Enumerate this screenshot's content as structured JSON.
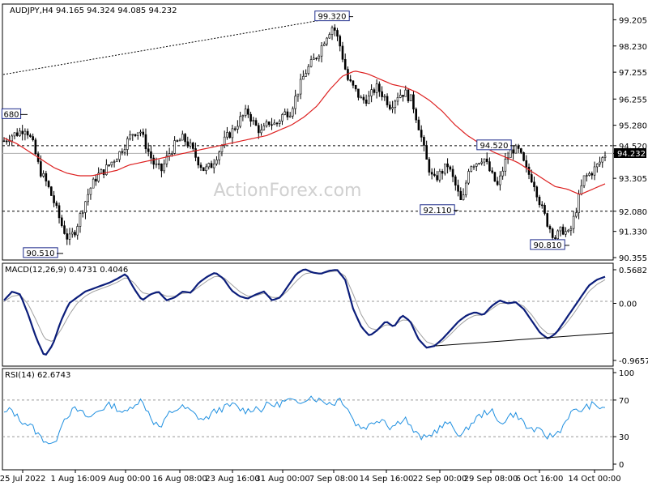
{
  "chart_data": [
    {
      "type": "candlestick",
      "title": "AUDJPY,H4  94.165 94.324 94.085 94.232",
      "watermark": "ActionForex.com",
      "last_price": "94.232",
      "y_ticks": [
        "99.205",
        "98.230",
        "97.255",
        "96.255",
        "95.280",
        "94.520",
        "94.232",
        "93.305",
        "92.080",
        "91.330",
        "90.355"
      ],
      "ylim": [
        90.355,
        99.7
      ],
      "close_path": [
        94.7,
        94.9,
        95.0,
        95.2,
        94.6,
        93.6,
        93.1,
        92.4,
        91.6,
        91.0,
        91.4,
        92.2,
        92.9,
        93.4,
        93.6,
        93.9,
        94.2,
        94.6,
        95.0,
        95.1,
        94.4,
        93.8,
        93.6,
        94.2,
        94.6,
        94.8,
        94.5,
        94.0,
        93.6,
        93.8,
        94.3,
        94.8,
        95.1,
        95.5,
        95.8,
        95.3,
        95.0,
        95.4,
        95.3,
        95.7,
        95.8,
        96.5,
        97.2,
        97.6,
        98.0,
        98.6,
        99.0,
        98.2,
        97.0,
        96.6,
        96.2,
        96.3,
        96.7,
        96.4,
        96.0,
        96.4,
        96.5,
        96.2,
        95.2,
        94.0,
        93.2,
        93.5,
        93.8,
        93.1,
        92.3,
        93.8,
        93.9,
        94.1,
        93.5,
        93.0,
        93.9,
        94.4,
        94.3,
        93.6,
        93.2,
        92.3,
        91.6,
        91.1,
        91.4,
        91.2,
        92.2,
        93.3,
        93.5,
        93.8,
        94.2
      ],
      "sma_path": [
        94.8,
        94.6,
        94.3,
        94.0,
        93.7,
        93.5,
        93.4,
        93.4,
        93.5,
        93.6,
        93.8,
        93.9,
        94.0,
        94.1,
        94.2,
        94.3,
        94.4,
        94.5,
        94.6,
        94.7,
        94.8,
        94.9,
        95.1,
        95.3,
        95.6,
        96.0,
        96.6,
        97.1,
        97.3,
        97.2,
        97.0,
        96.8,
        96.7,
        96.5,
        96.2,
        95.8,
        95.3,
        94.9,
        94.6,
        94.3,
        94.1,
        93.9,
        93.6,
        93.3,
        93.0,
        92.9,
        92.7,
        92.9,
        93.1
      ],
      "dashed_levels": [
        94.52,
        92.08
      ],
      "gray_level": 94.232,
      "trendline_text": "",
      "annotations": [
        {
          "label": "99.320",
          "value": 99.32
        },
        {
          "label": "680",
          "value": 95.68
        },
        {
          "label": "90.510",
          "value": 90.51
        },
        {
          "label": "94.520",
          "value": 94.52
        },
        {
          "label": "92.110",
          "value": 92.11
        },
        {
          "label": "90.810",
          "value": 90.81
        }
      ],
      "x_labels": [
        "25 Jul 2022",
        "1 Aug 16:00",
        "9 Aug 00:00",
        "16 Aug 08:00",
        "23 Aug 16:00",
        "31 Aug 00:00",
        "7 Sep 08:00",
        "14 Sep 16:00",
        "22 Sep 00:00",
        "29 Sep 08:00",
        "6 Oct 16:00",
        "14 Oct 00:00"
      ]
    },
    {
      "type": "line",
      "title": "MACD(12,26,9) 0.4731 0.4046",
      "y_ticks": [
        "0.5682",
        "0.00",
        "-0.9657"
      ],
      "ylim": [
        -0.9657,
        0.5682
      ],
      "macd": [
        0.05,
        0.2,
        0.15,
        -0.2,
        -0.6,
        -0.9,
        -0.7,
        -0.3,
        0.0,
        0.1,
        0.2,
        0.25,
        0.3,
        0.35,
        0.42,
        0.5,
        0.25,
        0.05,
        0.15,
        0.2,
        0.05,
        0.1,
        0.2,
        0.18,
        0.35,
        0.45,
        0.52,
        0.42,
        0.22,
        0.12,
        0.08,
        0.15,
        0.2,
        0.05,
        0.1,
        0.3,
        0.5,
        0.58,
        0.52,
        0.5,
        0.55,
        0.57,
        0.4,
        -0.1,
        -0.4,
        -0.55,
        -0.45,
        -0.3,
        -0.4,
        -0.2,
        -0.3,
        -0.6,
        -0.75,
        -0.72,
        -0.6,
        -0.45,
        -0.3,
        -0.2,
        -0.15,
        -0.2,
        -0.05,
        0.05,
        0.0,
        0.02,
        -0.1,
        -0.3,
        -0.5,
        -0.6,
        -0.5,
        -0.3,
        -0.1,
        0.1,
        0.3,
        0.4,
        0.45
      ],
      "signal": [
        0.03,
        0.12,
        0.14,
        -0.02,
        -0.3,
        -0.6,
        -0.65,
        -0.45,
        -0.2,
        0.0,
        0.12,
        0.2,
        0.25,
        0.3,
        0.36,
        0.44,
        0.35,
        0.18,
        0.15,
        0.18,
        0.12,
        0.12,
        0.17,
        0.18,
        0.28,
        0.38,
        0.46,
        0.44,
        0.32,
        0.2,
        0.12,
        0.13,
        0.17,
        0.1,
        0.1,
        0.22,
        0.38,
        0.5,
        0.52,
        0.51,
        0.53,
        0.55,
        0.46,
        0.15,
        -0.2,
        -0.42,
        -0.45,
        -0.36,
        -0.38,
        -0.28,
        -0.29,
        -0.48,
        -0.65,
        -0.7,
        -0.65,
        -0.52,
        -0.38,
        -0.27,
        -0.2,
        -0.2,
        -0.1,
        0.0,
        0.0,
        0.01,
        -0.05,
        -0.2,
        -0.4,
        -0.52,
        -0.5,
        -0.38,
        -0.2,
        0.0,
        0.2,
        0.32,
        0.4
      ]
    },
    {
      "type": "line",
      "title": "RSI(14) 62.6743",
      "y_ticks": [
        "100",
        "70",
        "30",
        "0"
      ],
      "ylim": [
        0,
        100
      ],
      "levels": [
        70,
        30
      ],
      "rsi": [
        55,
        60,
        50,
        45,
        40,
        30,
        25,
        20,
        45,
        55,
        60,
        55,
        50,
        58,
        62,
        65,
        60,
        55,
        65,
        70,
        60,
        45,
        40,
        55,
        60,
        62,
        58,
        52,
        48,
        55,
        60,
        62,
        65,
        60,
        58,
        62,
        60,
        66,
        64,
        68,
        70,
        65,
        72,
        74,
        70,
        68,
        66,
        72,
        62,
        45,
        40,
        42,
        48,
        50,
        40,
        45,
        52,
        38,
        30,
        28,
        35,
        40,
        45,
        38,
        30,
        42,
        50,
        55,
        60,
        45,
        48,
        55,
        52,
        40,
        38,
        35,
        30,
        32,
        40,
        55,
        58,
        60,
        65,
        62,
        63
      ]
    }
  ]
}
